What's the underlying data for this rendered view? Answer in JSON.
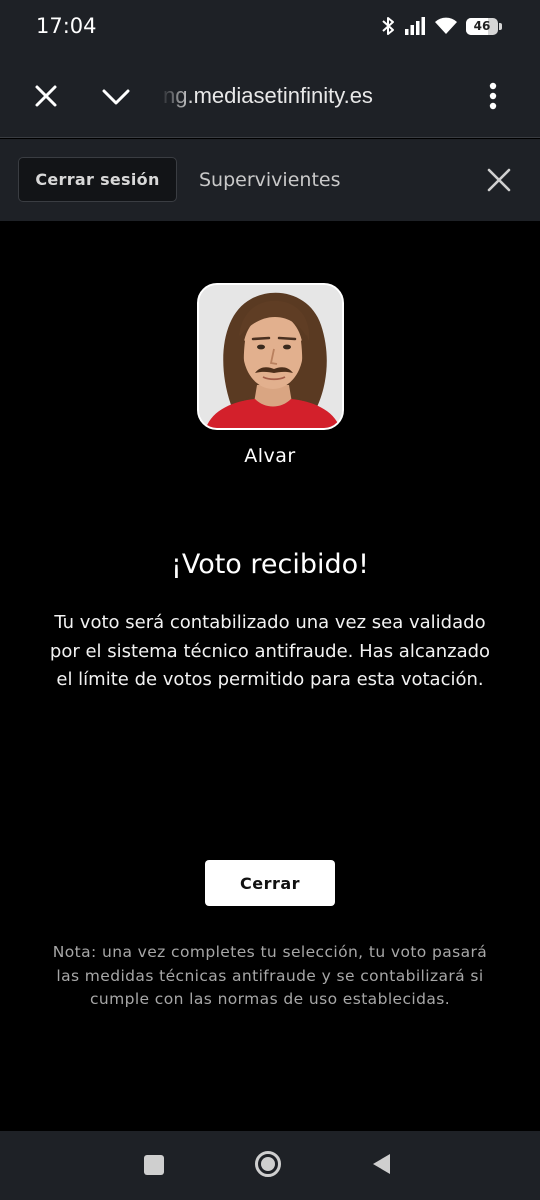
{
  "status_bar": {
    "time": "17:04",
    "battery_level": "46",
    "icons": [
      "bluetooth-icon",
      "signal-icon",
      "wifi-icon",
      "battery-icon"
    ]
  },
  "browser": {
    "url": "ng.mediasetinfinity.es",
    "icons": [
      "close-icon",
      "chevron-down-icon",
      "more-vert-icon"
    ]
  },
  "tab_bar": {
    "sign_out_label": "Cerrar sesión",
    "title": "Supervivientes"
  },
  "candidate": {
    "name": "Alvar"
  },
  "confirmation": {
    "title": "¡Voto recibido!",
    "message": "Tu voto será contabilizado una vez sea validado por el sistema técnico antifraude. Has alcanzado el límite de votos permitido para esta votación.",
    "close_label": "Cerrar",
    "note": "Nota: una vez completes tu selección, tu voto pasará las medidas técnicas antifraude y se contabilizará si cumple con las normas de uso establecidas."
  },
  "nav_bar": {
    "icons": [
      "recents-icon",
      "home-icon",
      "back-icon"
    ]
  },
  "colors": {
    "background": "#000000",
    "chrome": "#1e2126",
    "shirt": "#d3202b",
    "note_text": "#a7a7a7"
  }
}
